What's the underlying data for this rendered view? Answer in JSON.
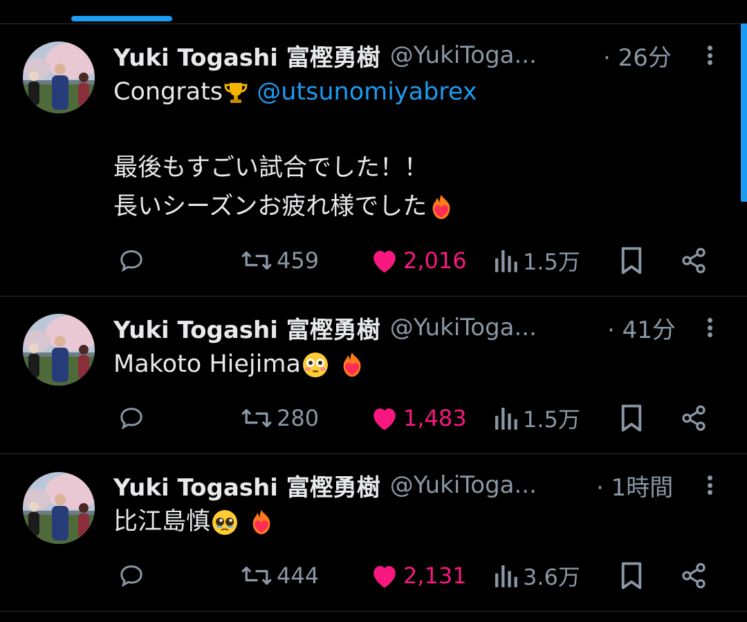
{
  "colors": {
    "accent": "#1d9bf0",
    "like": "#f91880",
    "muted": "#8b98a5",
    "text": "#e7e9ea"
  },
  "tweets": [
    {
      "name": "Yuki Togashi 富樫勇樹",
      "handle": "@YukiToga...",
      "time": "· 26分",
      "line1_prefix": "Congrats",
      "line1_mention": "@utsunomiyabrex",
      "line2": "最後もすごい試合でした！！",
      "line3": "長いシーズンお疲れ様でした",
      "retweets": "459",
      "likes": "2,016",
      "views": "1.5万"
    },
    {
      "name": "Yuki Togashi 富樫勇樹",
      "handle": "@YukiToga...",
      "time": "· 41分",
      "text": "Makoto Hiejima",
      "retweets": "280",
      "likes": "1,483",
      "views": "1.5万"
    },
    {
      "name": "Yuki Togashi 富樫勇樹",
      "handle": "@YukiToga...",
      "time": "· 1時間",
      "text": "比江島慎",
      "retweets": "444",
      "likes": "2,131",
      "views": "3.6万"
    }
  ]
}
